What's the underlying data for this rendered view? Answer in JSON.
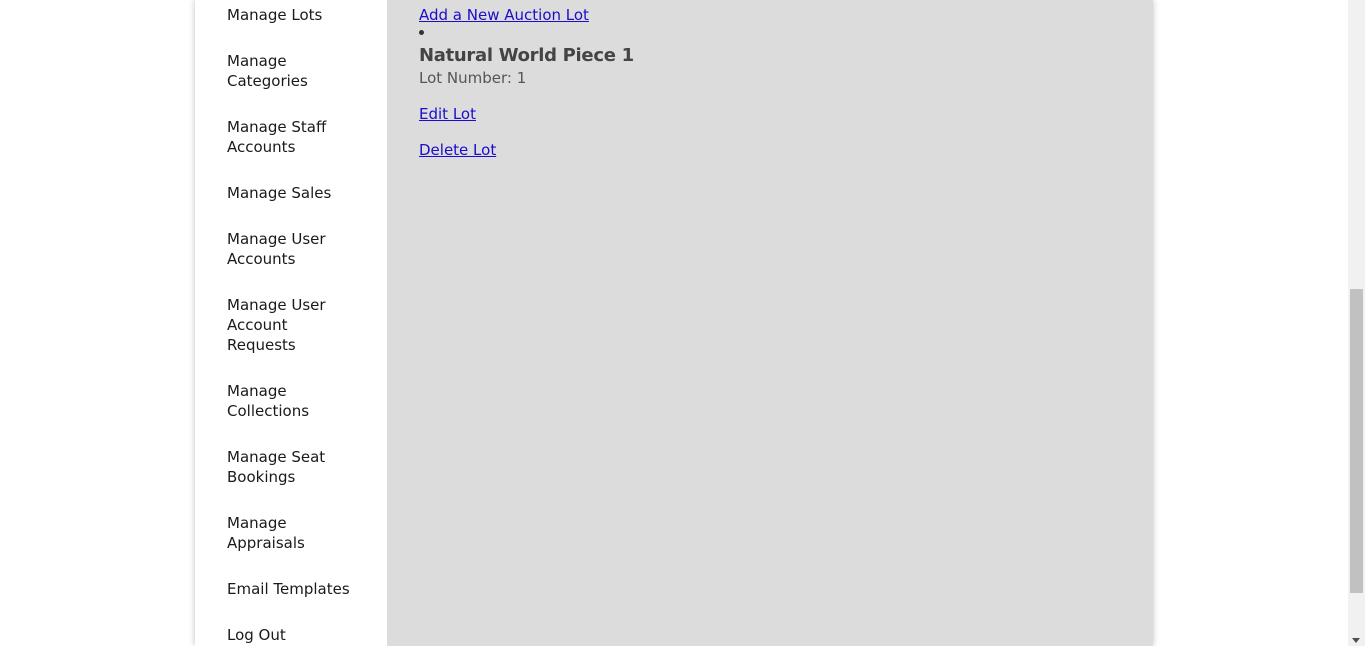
{
  "sidebar": {
    "items": [
      {
        "label": "Manage Lots"
      },
      {
        "label": "Manage Categories"
      },
      {
        "label": "Manage Staff Accounts"
      },
      {
        "label": "Manage Sales"
      },
      {
        "label": "Manage User Accounts"
      },
      {
        "label": "Manage User Account Requests"
      },
      {
        "label": "Manage Collections"
      },
      {
        "label": "Manage Seat Bookings"
      },
      {
        "label": "Manage Appraisals"
      },
      {
        "label": "Email Templates"
      },
      {
        "label": "Log Out"
      }
    ]
  },
  "main": {
    "add_lot_link": "Add a New Auction Lot",
    "lot": {
      "title": "Natural World Piece 1",
      "lot_number": "Lot Number: 1",
      "edit_link": "Edit Lot",
      "delete_link": "Delete Lot"
    }
  },
  "colors": {
    "link": "#1a0dcc",
    "main_background": "#dcdcdc",
    "sidebar_background": "#ffffff"
  }
}
